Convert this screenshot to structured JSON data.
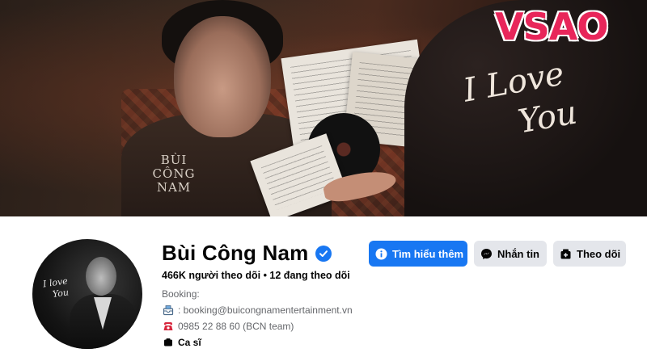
{
  "cover": {
    "logo_line1": "BÙI",
    "logo_line2": "CÔNG",
    "logo_line3": "NAM",
    "script_line1": "I Love",
    "script_line2": "You"
  },
  "watermark": {
    "text": "VSAO"
  },
  "avatar": {
    "script_line1": "I love",
    "script_line2": "You"
  },
  "profile": {
    "name": "Bùi Công Nam",
    "stats": "466K người theo dõi • 12 đang theo dõi",
    "booking_label": "Booking:",
    "email": ": booking@buicongnamentertainment.vn",
    "phone": "0985 22 88 60 (BCN team)",
    "category": "Ca sĩ"
  },
  "actions": {
    "learn_more": "Tìm hiểu thêm",
    "message": "Nhắn tin",
    "follow": "Theo dõi"
  },
  "colors": {
    "primary": "#1877f2",
    "secondary": "#e4e6eb",
    "watermark": "#e8265a"
  }
}
